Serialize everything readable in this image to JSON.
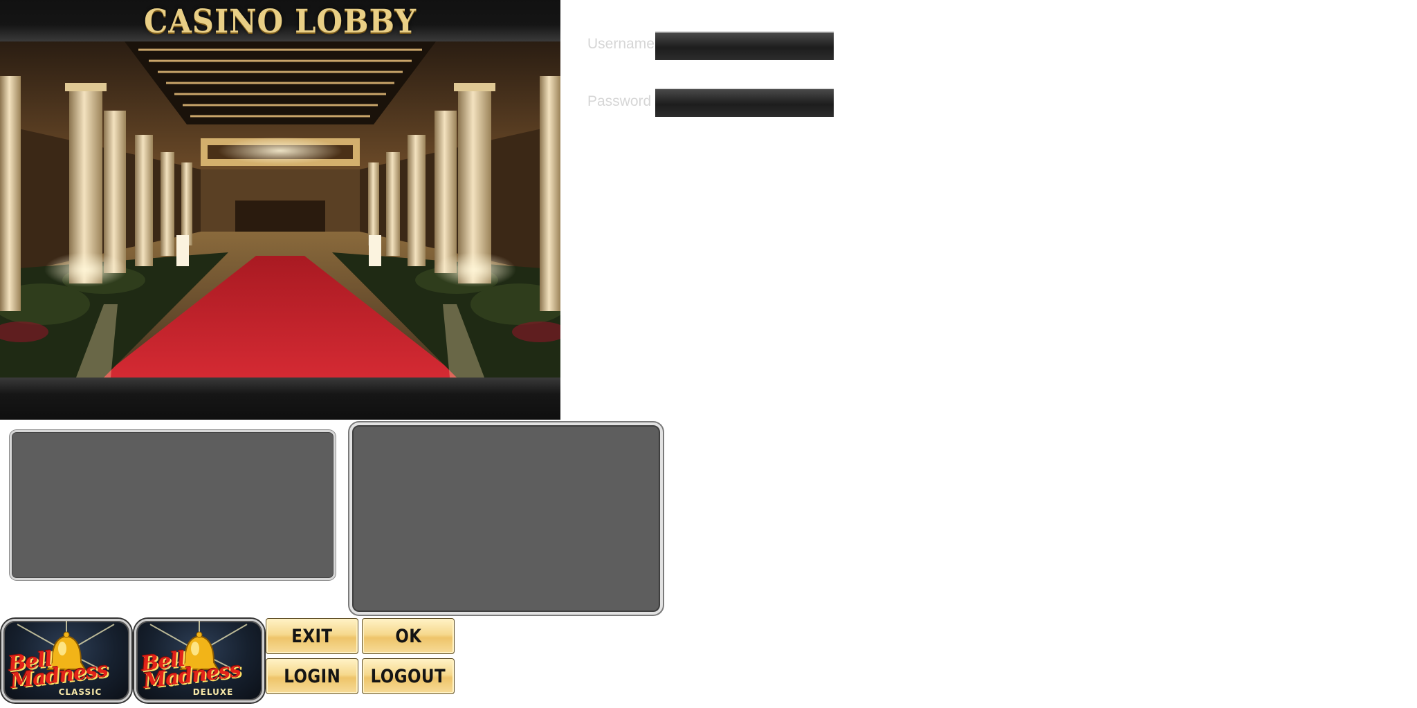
{
  "lobby": {
    "title": "CASINO LOBBY"
  },
  "login": {
    "username_label": "Username",
    "password_label": "Password",
    "username_value": "",
    "password_value": ""
  },
  "games": [
    {
      "title_line1": "Bell",
      "title_line2": "Madness",
      "edition": "CLASSIC",
      "icon": "bell-icon"
    },
    {
      "title_line1": "Bell",
      "title_line2": "Madness",
      "edition": "DELUXE",
      "icon": "bell-icon"
    }
  ],
  "buttons": {
    "exit": "EXIT",
    "ok": "OK",
    "login": "LOGIN",
    "logout": "LOGOUT"
  },
  "colors": {
    "title_gold": "#e9cf86",
    "button_gold": "#f6d98e",
    "panel_gray": "#5e5e5e",
    "carpet_red": "#c8202a"
  }
}
